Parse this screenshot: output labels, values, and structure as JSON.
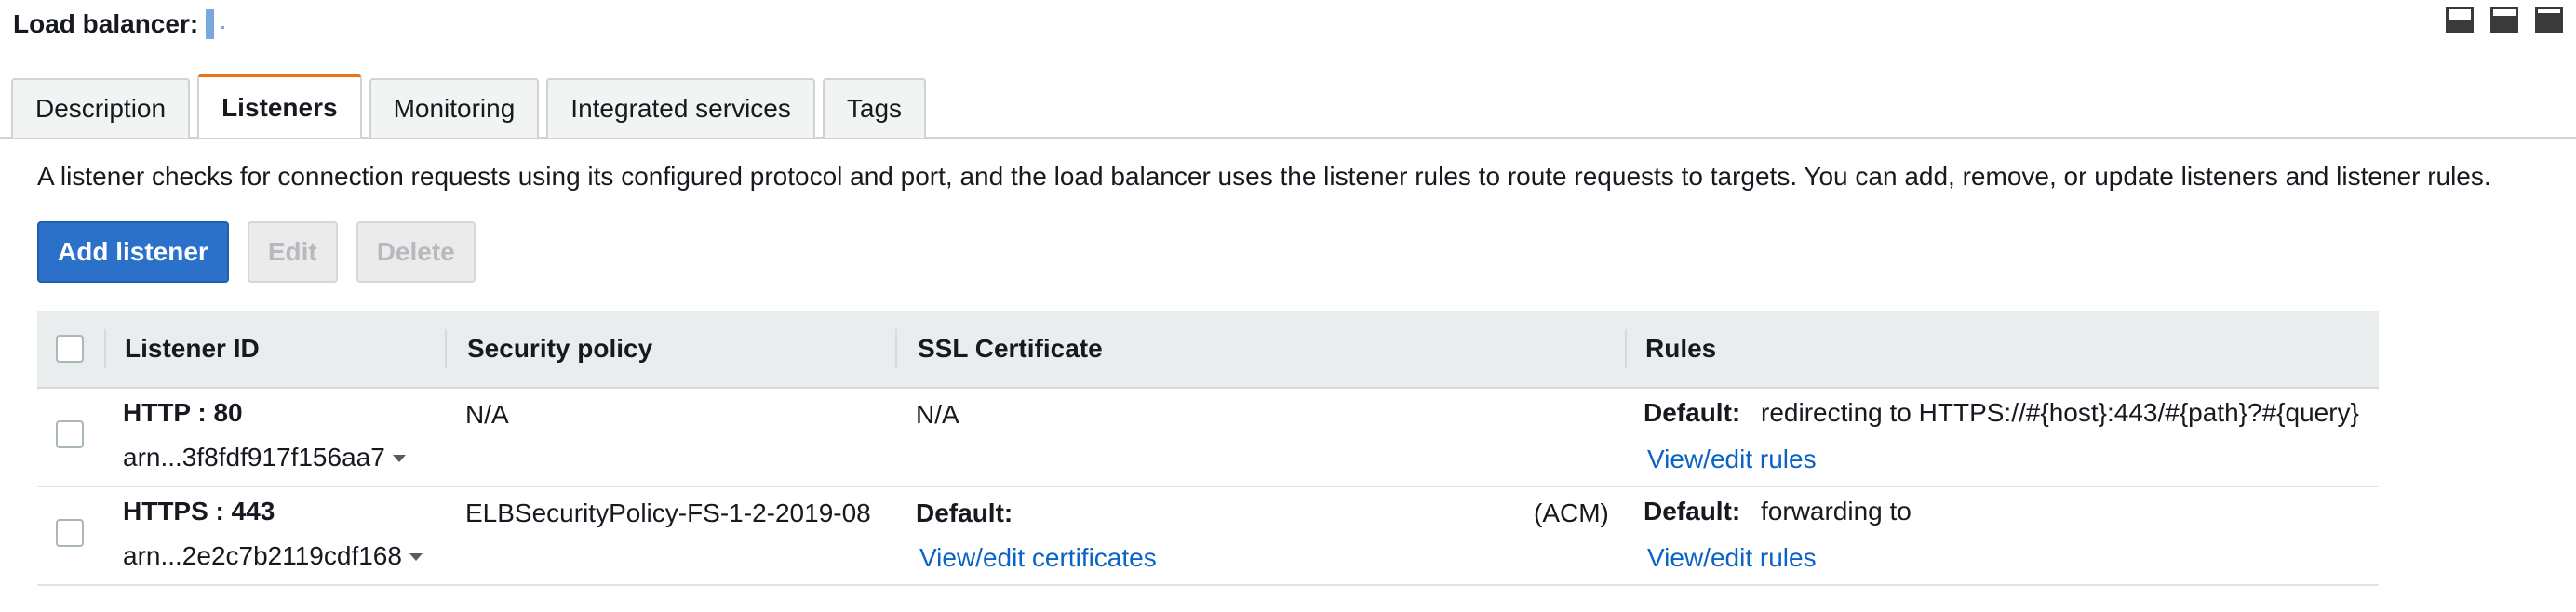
{
  "header": {
    "title": "Load balancer:"
  },
  "layout_controls": [
    "panel-bottom-icon",
    "panel-split-icon",
    "panel-top-icon"
  ],
  "tabs": [
    {
      "label": "Description",
      "active": false
    },
    {
      "label": "Listeners",
      "active": true
    },
    {
      "label": "Monitoring",
      "active": false
    },
    {
      "label": "Integrated services",
      "active": false
    },
    {
      "label": "Tags",
      "active": false
    }
  ],
  "intro_text": "A listener checks for connection requests using its configured protocol and port, and the load balancer uses the listener rules to route requests to targets. You can add, remove, or update listeners and listener rules.",
  "actions": {
    "add_label": "Add listener",
    "edit_label": "Edit",
    "delete_label": "Delete"
  },
  "table": {
    "columns": [
      "Listener ID",
      "Security policy",
      "SSL Certificate",
      "Rules"
    ],
    "rows": [
      {
        "protocol": "HTTP : 80",
        "arn": "arn...3f8fdf917f156aa7",
        "security_policy": "N/A",
        "ssl_certificate": "N/A",
        "rule_default_label": "Default:",
        "rule_default_value": "redirecting to HTTPS://#{host}:443/#{path}?#{query}",
        "rules_link": "View/edit rules"
      },
      {
        "protocol": "HTTPS : 443",
        "arn": "arn...2e2c7b2119cdf168",
        "security_policy": "ELBSecurityPolicy-FS-1-2-2019-08",
        "ssl_default_label": "Default:",
        "ssl_source": "(ACM)",
        "ssl_link": "View/edit certificates",
        "rule_default_label": "Default:",
        "rule_default_value": "forwarding to",
        "rules_link": "View/edit rules"
      }
    ]
  },
  "colors": {
    "primary_button": "#2b70c9",
    "active_tab_accent": "#ec7211",
    "link": "#0b63c5",
    "table_header_bg": "#eaeded"
  }
}
